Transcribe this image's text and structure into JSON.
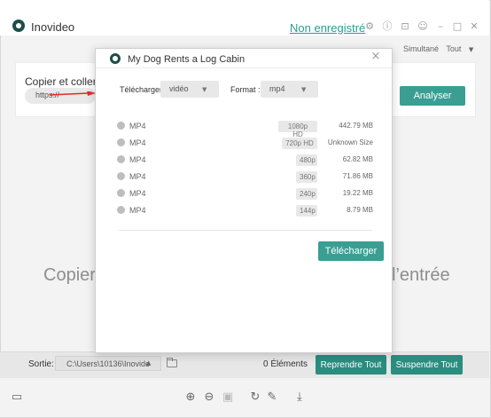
{
  "app": {
    "title": "Inovideo",
    "register_link": "Non enregistré",
    "icons": [
      "settings-icon",
      "info-icon",
      "cart-icon",
      "feedback-icon",
      "minimize-icon",
      "maximize-icon",
      "close-icon"
    ]
  },
  "background": {
    "top_right_tabs": [
      "Simultané",
      "Tout"
    ],
    "copy_label": "Copier et coller l",
    "url_text": "https://",
    "analyse_button": "Analyser",
    "hint_left": "Copier",
    "hint_right": "l’entrée",
    "colors": {
      "accent": "#3a9e93",
      "accent_dark": "#2a8d80",
      "link": "#2a9d8f"
    }
  },
  "bottom": {
    "sortie_label": "Sortie:",
    "output_path": "C:\\Users\\10136\\Inovide",
    "items_count": "0 Éléments",
    "resume_all": "Reprendre Tout",
    "pause_all": "Suspendre Tout",
    "toolbar_icons": [
      "panel-icon",
      "zoom-in-icon",
      "zoom-out-icon",
      "fit-icon",
      "refresh-icon",
      "edit-icon",
      "download-icon"
    ]
  },
  "modal": {
    "title": "My Dog Rents a Log Cabin",
    "download_label": "Télécharger",
    "download_type": "vidéo",
    "format_label": "Format :",
    "format_value": "mp4",
    "rows": [
      {
        "format": "MP4",
        "resolution": "1080p HD",
        "size": "442.79 MB"
      },
      {
        "format": "MP4",
        "resolution": "720p HD",
        "size": "Unknown Size"
      },
      {
        "format": "MP4",
        "resolution": "480p",
        "size": "62.82 MB"
      },
      {
        "format": "MP4",
        "resolution": "360p",
        "size": "71.86 MB"
      },
      {
        "format": "MP4",
        "resolution": "240p",
        "size": "19.22 MB"
      },
      {
        "format": "MP4",
        "resolution": "144p",
        "size": "8.79 MB"
      }
    ],
    "download_button": "Télécharger"
  }
}
